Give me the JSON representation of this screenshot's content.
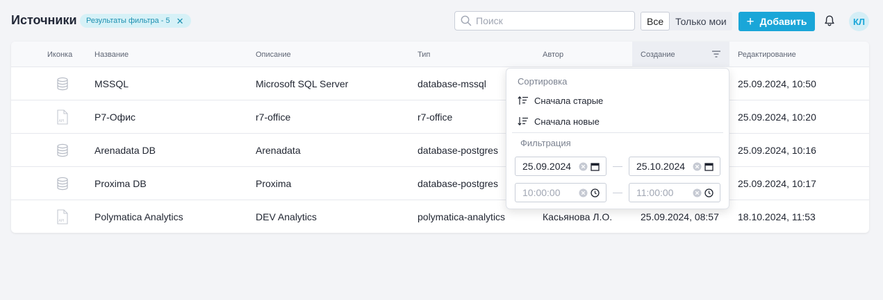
{
  "header": {
    "title": "Источники",
    "filter_chip": {
      "label": "Результаты фильтра - 5"
    },
    "search": {
      "placeholder": "Поиск",
      "value": ""
    },
    "segment": {
      "all_label": "Все",
      "mine_label": "Только мои",
      "selected": "Все"
    },
    "add_label": "Добавить",
    "avatar_initials": "КЛ"
  },
  "table": {
    "columns": {
      "icon": "Иконка",
      "name": "Название",
      "description": "Описание",
      "type": "Тип",
      "author": "Автор",
      "created": "Создание",
      "edited": "Редактирование"
    },
    "rows": [
      {
        "icon": "database-icon",
        "name": "MSSQL",
        "description": "Microsoft SQL Server",
        "type": "database-mssql",
        "author": "",
        "created": "",
        "edited": "25.09.2024, 10:50"
      },
      {
        "icon": "api-file-icon",
        "name": "Р7-Офис",
        "description": "r7-office",
        "type": "r7-office",
        "author": "",
        "created": "",
        "edited": "25.09.2024, 10:20"
      },
      {
        "icon": "database-icon",
        "name": "Arenadata DB",
        "description": "Arenadata",
        "type": "database-postgres",
        "author": "",
        "created": "",
        "edited": "25.09.2024, 10:16"
      },
      {
        "icon": "database-icon",
        "name": "Proxima DB",
        "description": "Proxima",
        "type": "database-postgres",
        "author": "",
        "created": "",
        "edited": "25.09.2024, 10:17"
      },
      {
        "icon": "api-file-icon",
        "name": "Polymatica Analytics",
        "description": "DEV Analytics",
        "type": "polymatica-analytics",
        "author": "Касьянова Л.О.",
        "created": "25.09.2024, 08:57",
        "edited": "18.10.2024, 11:53"
      }
    ]
  },
  "dropdown": {
    "sort_title": "Сортировка",
    "sort_oldest": "Сначала старые",
    "sort_newest": "Сначала новые",
    "filter_title": "Фильтрация",
    "date_from": "25.09.2024",
    "date_to": "25.10.2024",
    "time_from": "10:00:00",
    "time_to": "11:00:00"
  },
  "colors": {
    "accent": "#1aa6d8",
    "chip_bg": "#d6f1f7",
    "chip_text": "#1b8fb0"
  }
}
